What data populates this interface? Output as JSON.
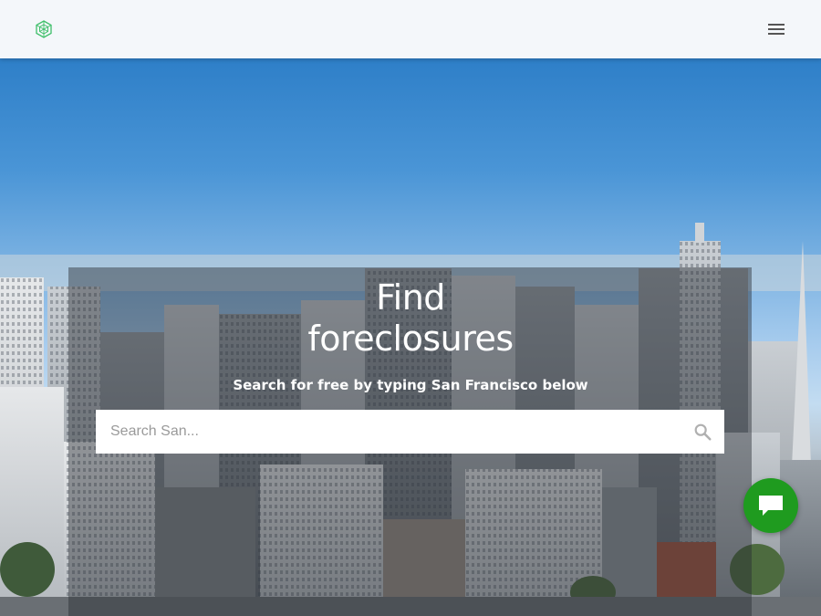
{
  "header": {
    "logo_icon": "hexagon-logo-icon",
    "menu_icon": "hamburger-menu-icon"
  },
  "hero": {
    "title_line1": "Find",
    "title_line2": "foreclosures",
    "subtitle": "Search for free by typing San Francisco below",
    "background": "san-francisco-skyline-photo"
  },
  "search": {
    "placeholder": "Search San...",
    "value": "",
    "icon": "search-icon"
  },
  "chat": {
    "icon": "chat-bubble-icon"
  },
  "colors": {
    "header_bg": "#f4f7fa",
    "logo_green": "#3fbf6a",
    "chat_green": "#1f9b1f",
    "overlay": "rgba(40,44,52,0.45)"
  }
}
